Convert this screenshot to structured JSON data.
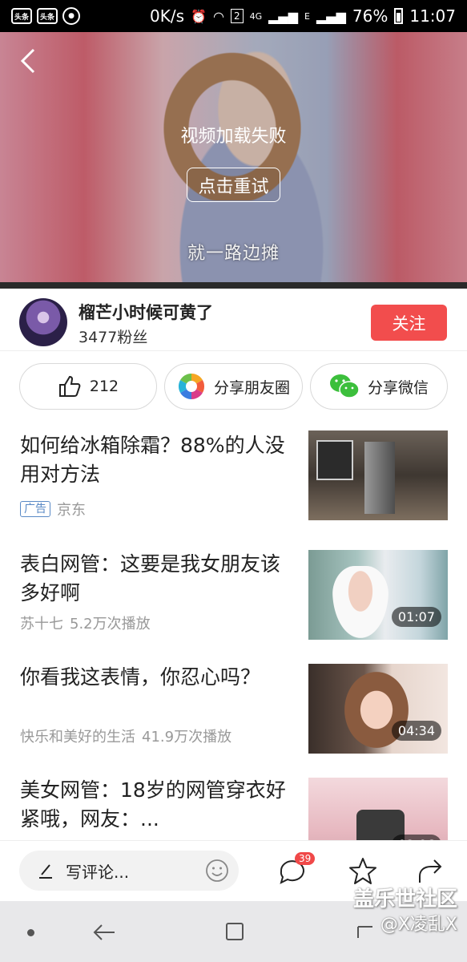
{
  "status_bar": {
    "apps": [
      "头条",
      "头条"
    ],
    "network_speed": "0K/s",
    "sim_number": "2",
    "network_type": "4G",
    "network_type_2": "E",
    "battery": "76%",
    "time": "11:07"
  },
  "video": {
    "error_text": "视频加载失败",
    "retry_label": "点击重试",
    "subtitle": "就一路边摊"
  },
  "author": {
    "name": "榴芒小时候可黄了",
    "fans": "3477粉丝",
    "follow_label": "关注"
  },
  "actions": {
    "like_count": "212",
    "share_moments_label": "分享朋友圈",
    "share_wechat_label": "分享微信"
  },
  "feed": [
    {
      "title": "如何给冰箱除霜？88%的人没用对方法",
      "ad_badge": "广告",
      "source": "京东",
      "plays": "",
      "duration": "",
      "thumb_icon": "refrigerator-thumbnail"
    },
    {
      "title": "表白网管：这要是我女朋友该多好啊",
      "source": "苏十七",
      "plays": "5.2万次播放",
      "duration": "01:07",
      "thumb_icon": "video-thumbnail"
    },
    {
      "title": "你看我这表情，你忍心吗？",
      "source": "快乐和美好的生活",
      "plays": "41.9万次播放",
      "duration": "04:34",
      "thumb_icon": "video-thumbnail"
    },
    {
      "title": "美女网管：18岁的网管穿衣好紧哦，网友：...",
      "source": "",
      "plays": "",
      "duration": "02:06",
      "thumb_icon": "video-thumbnail"
    }
  ],
  "comment_bar": {
    "placeholder": "写评论...",
    "comment_count": "39"
  },
  "watermark": {
    "line1": "盖乐世社区",
    "line2": "@X凌乱X"
  },
  "colors": {
    "accent_red": "#f24d4d",
    "badge_red": "#f04848",
    "ad_blue": "#5a8ac6"
  }
}
